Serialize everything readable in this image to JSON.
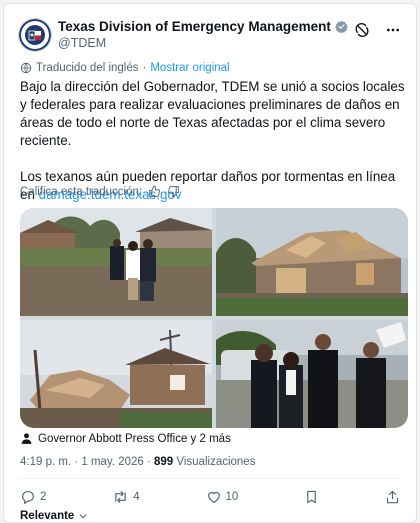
{
  "post": {
    "display_name": "Texas Division of Emergency Management",
    "handle": "@TDEM",
    "translated_label": "Traducido del inglés",
    "show_original": "Mostrar original",
    "paragraph_1": "Bajo la dirección del Gobernador, TDEM se unió a socios locales y federales para realizar evaluaciones preliminares de daños en áreas de todo el norte de Texas afectadas por el clima severo reciente.",
    "paragraph_2_text": "Los texanos aún pueden reportar daños por tormentas en línea en ",
    "paragraph_2_link": "damage.tdem.texas.gov",
    "rate_translation": "Califica esta traducción:",
    "credit": "Governor Abbott Press Office y 2 más",
    "time": "4:19 p. m. · 1 may. 2026 · ",
    "views_count": "899",
    "views_label": " Visualizaciones"
  },
  "actions": {
    "replies": "2",
    "reposts": "4",
    "likes": "10"
  },
  "sort": {
    "label": "Relevante"
  },
  "colors": {
    "accent": "#1d9bf0",
    "verified": "#829aab",
    "secondary_text": "#536471"
  },
  "icons": [
    "verified-badge-icon",
    "grok-icon",
    "more-icon",
    "translate-icon",
    "thumbs-up-icon",
    "thumbs-down-icon",
    "person-icon",
    "reply-icon",
    "repost-icon",
    "like-icon",
    "bookmark-icon",
    "share-icon",
    "chevron-down-icon"
  ]
}
